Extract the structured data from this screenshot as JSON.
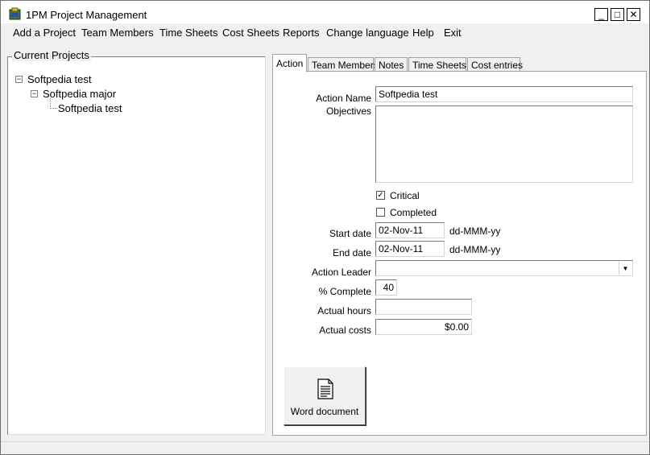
{
  "window": {
    "title": "1PM Project Management"
  },
  "titlebar_buttons": {
    "minimize": "_",
    "maximize": "□",
    "close": "✕"
  },
  "menu": [
    "Add a Project",
    "Team Members",
    "Time Sheets",
    "Cost Sheets",
    "Reports",
    "Change language",
    "Help",
    "Exit"
  ],
  "tree": {
    "group_label": "Current Projects",
    "nodes": [
      "Softpedia test",
      "Softpedia major",
      "Softpedia test"
    ],
    "expander_symbol": "−"
  },
  "tabs": [
    "Action",
    "Team Members",
    "Notes",
    "Time Sheets",
    "Cost entries"
  ],
  "form": {
    "action_name_label": "Action Name",
    "action_name_value": "Softpedia test",
    "objectives_label": "Objectives",
    "objectives_value": "",
    "critical_label": "Critical",
    "critical_checked": true,
    "completed_label": "Completed",
    "completed_checked": false,
    "check_mark": "✓",
    "start_date_label": "Start date",
    "start_date_value": "02-Nov-11",
    "end_date_label": "End date",
    "end_date_value": "02-Nov-11",
    "date_format_hint": "dd-MMM-yy",
    "action_leader_label": "Action Leader",
    "action_leader_value": "",
    "percent_complete_label": "% Complete",
    "percent_complete_value": "40",
    "actual_hours_label": "Actual hours",
    "actual_hours_value": "",
    "actual_costs_label": "Actual costs",
    "actual_costs_value": "$0.00"
  },
  "word_document_button": "Word document",
  "icons": {
    "app": "app-icon",
    "tree_expander": "minus-box-icon",
    "dropdown": "chevron-down-icon",
    "word": "document-icon"
  }
}
